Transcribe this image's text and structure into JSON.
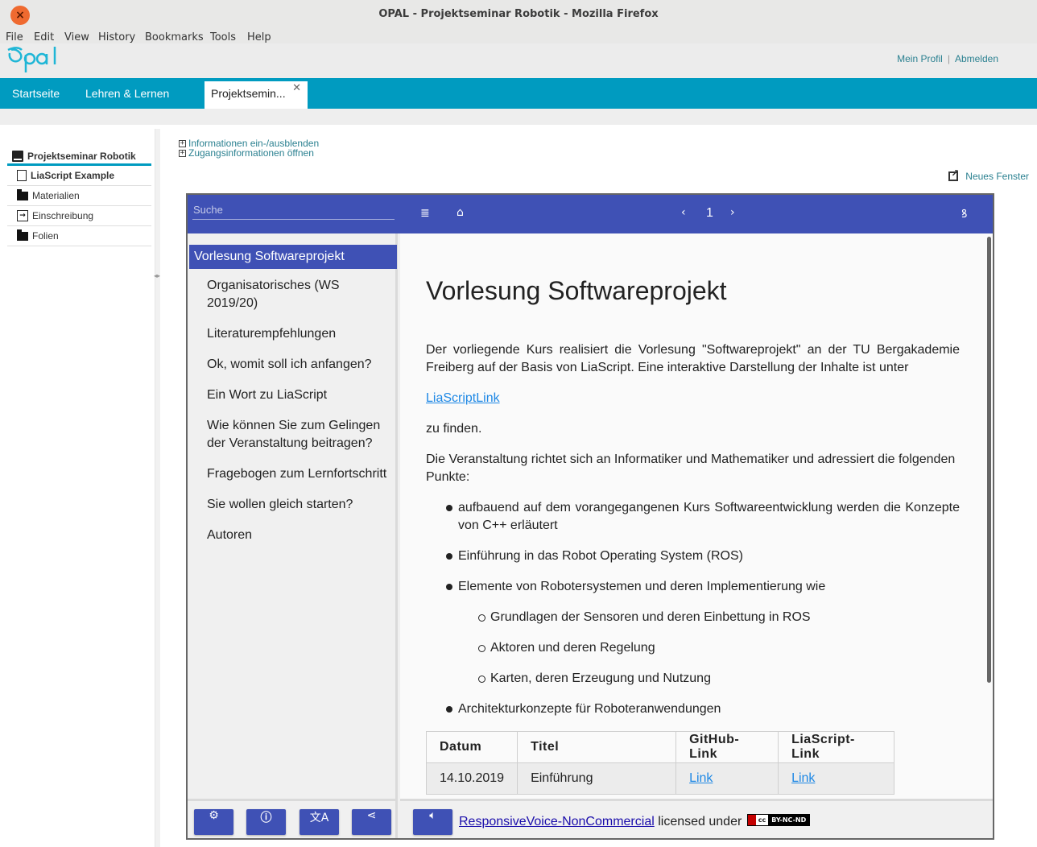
{
  "window": {
    "title": "OPAL - Projektseminar Robotik - Mozilla Firefox",
    "close_glyph": "×"
  },
  "menubar": [
    "File",
    "Edit",
    "View",
    "History",
    "Bookmarks",
    "Tools",
    "Help"
  ],
  "header": {
    "logo_text": "opal",
    "links": [
      "Mein Profil",
      "Abmelden"
    ],
    "separator": "|"
  },
  "nav": {
    "items": [
      "Startseite",
      "Lehren & Lernen"
    ],
    "active_tab": "Projektsemin...",
    "active_tab_close": "✕"
  },
  "course_tree": {
    "root": "Projektseminar Robotik",
    "items": [
      {
        "label": "LiaScript Example",
        "icon": "page-icon"
      },
      {
        "label": "Materialien",
        "icon": "folder-icon"
      },
      {
        "label": "Einschreibung",
        "icon": "enroll-icon"
      },
      {
        "label": "Folien",
        "icon": "folder-icon"
      }
    ]
  },
  "info_links": [
    "Informationen ein-/ausblenden",
    "Zugangsinformationen öffnen"
  ],
  "new_window": "Neues Fenster",
  "lia": {
    "search_placeholder": "Suche",
    "page_number": "1",
    "toc_active": "Vorlesung Softwareprojekt",
    "toc": [
      "Organisatorisches (WS 2019/20)",
      "Literaturempfehlungen",
      "Ok, womit soll ich anfangen?",
      "Ein Wort zu LiaScript",
      "Wie können Sie zum Gelingen der Veranstaltung beitragen?",
      "Fragebogen zum Lernfortschritt",
      "Sie wollen gleich starten?",
      "Autoren"
    ],
    "content": {
      "title": "Vorlesung Softwareprojekt",
      "p1": "Der vorliegende Kurs realisiert die Vorlesung \"Softwareprojekt\" an der TU Bergakademie Freiberg auf der Basis von LiaScript. Eine interaktive Darstellung der Inhalte ist unter",
      "link": "LiaScriptLink",
      "p2": "zu finden.",
      "p3": "Die Veranstaltung richtet sich an Informatiker und Mathematiker und adressiert die folgenden Punkte:",
      "bullets": [
        "aufbauend auf dem vorangegangenen Kurs Softwareentwicklung werden die Konzepte von C++ erläutert",
        "Einführung in das Robot Operating System (ROS)",
        "Elemente von Robotersystemen und deren Implementierung wie"
      ],
      "sub_bullets": [
        "Grundlagen der Sensoren und deren Einbettung in ROS",
        "Aktoren und deren Regelung",
        "Karten, deren Erzeugung und Nutzung"
      ],
      "last_bullet": "Architekturkonzepte für Roboteranwendungen",
      "table": {
        "headers": [
          "Datum",
          "Titel",
          "GitHub-Link",
          "LiaScript-Link"
        ],
        "rows": [
          [
            "14.10.2019",
            "Einführung",
            "Link",
            "Link"
          ]
        ]
      }
    },
    "footer": {
      "rv_link": "ResponsiveVoice-NonCommercial",
      "rv_text": "licensed under",
      "cc_text": "cc",
      "cc_license": "BY-NC-ND"
    }
  },
  "colors": {
    "opal_teal": "#009bc0",
    "lia_indigo": "#3f51b5",
    "link_teal": "#2a8090"
  }
}
